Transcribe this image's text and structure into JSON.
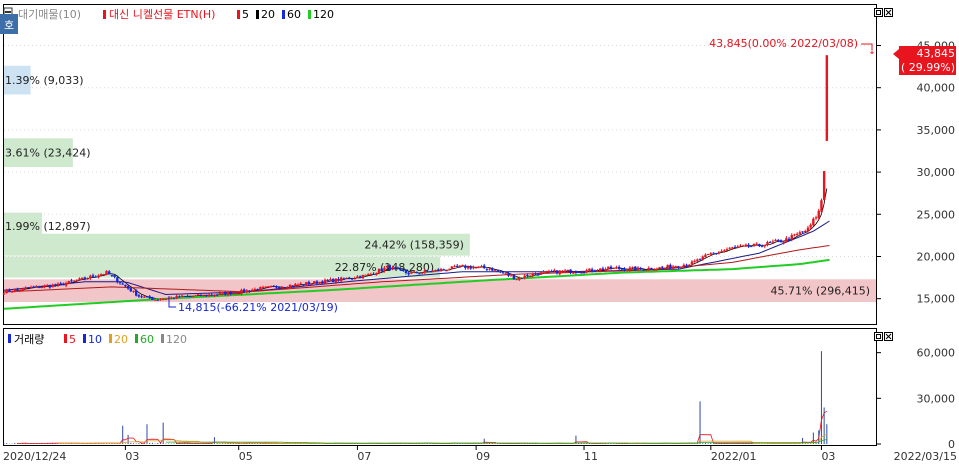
{
  "colors": {
    "price_up": "#e8141e",
    "price_down": "#1428d8",
    "ma5": "#000000",
    "ma20": "#1a1a8a",
    "ma60": "#b01a1a",
    "ma120": "#22cc22",
    "band_green": "#cfe9cf",
    "band_red": "#f2c6c8",
    "band_blue": "#cde2f2",
    "last_badge_bg": "#e8141e",
    "axis_text": "#333333"
  },
  "legend": {
    "top": {
      "waiting": "대기매물(10)",
      "symbol": "대신 니켈선물 ETN(H)",
      "ma": [
        "5",
        "20",
        "60",
        "120"
      ],
      "ma_colors": [
        "#e8141e",
        "#000000",
        "#1428d8",
        "#22cc22"
      ]
    },
    "bottom": {
      "volume": "거래량",
      "ma": [
        "5",
        "10",
        "20",
        "60",
        "120"
      ],
      "ma_colors": [
        "#e8141e",
        "#1428d8",
        "#e0a020",
        "#22aa22",
        "#888888"
      ]
    }
  },
  "corner_button": "호",
  "annotations": {
    "max_label": "43,845(0.00% 2022/03/08)",
    "min_label": "14,815(-66.21% 2021/03/19)",
    "last_price": "43,845",
    "last_change": "( 29.99%)"
  },
  "chart_data": [
    {
      "type": "candlestick",
      "y_ticks": [
        15000,
        20000,
        25000,
        30000,
        35000,
        40000,
        45000
      ],
      "y_tick_labels": [
        "15,000",
        "20,000",
        "25,000",
        "30,000",
        "35,000",
        "40,000",
        "45,000"
      ],
      "ylim": [
        12000,
        49800
      ],
      "x_tick_labels": [
        "2020/12/24",
        "03",
        "05",
        "07",
        "09",
        "11",
        "2022/01",
        "03",
        "2022/03/15"
      ],
      "x_tick_index": [
        0,
        45,
        87,
        131,
        175,
        215,
        262,
        303,
        321
      ],
      "n_bars": 322,
      "volume_profile": [
        {
          "label": "1.39% (9,033)",
          "value": 9033,
          "y_range": [
            39200,
            42600
          ],
          "color": "blue"
        },
        {
          "label": "3.61% (23,424)",
          "value": 23424,
          "y_range": [
            30600,
            34000
          ],
          "color": "green"
        },
        {
          "label": "1.99% (12,897)",
          "value": 12897,
          "y_range": [
            22000,
            25200
          ],
          "color": "green"
        },
        {
          "label": "24.42% (158,359)",
          "value": 158359,
          "y_range": [
            20100,
            22700
          ],
          "color": "green"
        },
        {
          "label": "22.87% (148,280)",
          "value": 148280,
          "y_range": [
            17500,
            20000
          ],
          "color": "green"
        },
        {
          "label": "45.71% (296,415)",
          "value": 296415,
          "y_range": [
            14600,
            17300
          ],
          "color": "red"
        }
      ],
      "close_keypoints": [
        [
          0,
          15800
        ],
        [
          10,
          16300
        ],
        [
          20,
          16600
        ],
        [
          30,
          17400
        ],
        [
          38,
          18100
        ],
        [
          44,
          16700
        ],
        [
          50,
          15300
        ],
        [
          56,
          14900
        ],
        [
          65,
          15200
        ],
        [
          75,
          15400
        ],
        [
          85,
          15700
        ],
        [
          95,
          16200
        ],
        [
          110,
          16700
        ],
        [
          125,
          17300
        ],
        [
          135,
          17800
        ],
        [
          142,
          18700
        ],
        [
          150,
          18000
        ],
        [
          160,
          18300
        ],
        [
          170,
          18800
        ],
        [
          180,
          18600
        ],
        [
          190,
          17400
        ],
        [
          196,
          17900
        ],
        [
          205,
          18200
        ],
        [
          215,
          18300
        ],
        [
          225,
          18600
        ],
        [
          235,
          18500
        ],
        [
          245,
          18700
        ],
        [
          255,
          19200
        ],
        [
          262,
          20300
        ],
        [
          270,
          21000
        ],
        [
          280,
          21300
        ],
        [
          290,
          22000
        ],
        [
          298,
          23200
        ],
        [
          302,
          25300
        ],
        [
          303,
          26700
        ],
        [
          304,
          30200
        ],
        [
          305,
          33700
        ]
      ],
      "last_candle": {
        "open": 33700,
        "high": 43845,
        "low": 33700,
        "close": 43845
      },
      "ma_keypoints": {
        "ma20": [
          [
            0,
            16000
          ],
          [
            30,
            17000
          ],
          [
            45,
            17000
          ],
          [
            60,
            15500
          ],
          [
            90,
            15800
          ],
          [
            130,
            17100
          ],
          [
            170,
            18200
          ],
          [
            210,
            18200
          ],
          [
            250,
            18500
          ],
          [
            280,
            20400
          ],
          [
            300,
            23000
          ],
          [
            306,
            24200
          ]
        ],
        "ma60": [
          [
            0,
            15800
          ],
          [
            40,
            16400
          ],
          [
            90,
            15800
          ],
          [
            140,
            17000
          ],
          [
            190,
            17900
          ],
          [
            240,
            18400
          ],
          [
            270,
            19300
          ],
          [
            295,
            20800
          ],
          [
            306,
            21300
          ]
        ],
        "ma120": [
          [
            0,
            13800
          ],
          [
            60,
            15000
          ],
          [
            120,
            16000
          ],
          [
            180,
            17200
          ],
          [
            230,
            18100
          ],
          [
            270,
            18500
          ],
          [
            295,
            19100
          ],
          [
            306,
            19600
          ]
        ]
      }
    },
    {
      "type": "bar",
      "name": "volume",
      "y_ticks": [
        0,
        30000,
        60000
      ],
      "y_tick_labels": [
        "0",
        "30,000",
        "60,000"
      ],
      "ylim": [
        0,
        67000
      ],
      "baseline": 400,
      "spikes": [
        {
          "i": 44,
          "v": 12000
        },
        {
          "i": 46,
          "v": 6000
        },
        {
          "i": 53,
          "v": 13000
        },
        {
          "i": 59,
          "v": 14000
        },
        {
          "i": 78,
          "v": 4500
        },
        {
          "i": 178,
          "v": 3500
        },
        {
          "i": 212,
          "v": 5500
        },
        {
          "i": 258,
          "v": 28000
        },
        {
          "i": 296,
          "v": 4000
        },
        {
          "i": 300,
          "v": 7500
        },
        {
          "i": 302,
          "v": 9000
        },
        {
          "i": 303,
          "v": 61000
        },
        {
          "i": 304,
          "v": 24000
        },
        {
          "i": 305,
          "v": 13000
        }
      ]
    }
  ]
}
